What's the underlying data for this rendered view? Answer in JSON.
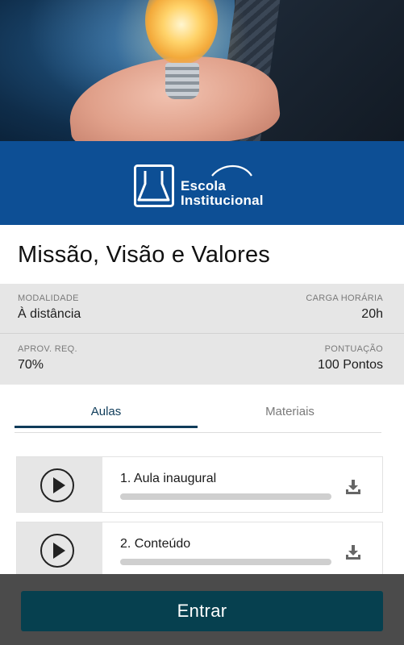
{
  "banner": {
    "logo_line1": "Escola",
    "logo_line2": "Institucional"
  },
  "course": {
    "title": "Missão, Visão e Valores"
  },
  "info": {
    "modalidade_label": "MODALIDADE",
    "modalidade_value": "À distância",
    "carga_label": "CARGA HORÁRIA",
    "carga_value": "20h",
    "aprov_label": "APROV. REQ.",
    "aprov_value": "70%",
    "pontuacao_label": "PONTUAÇÃO",
    "pontuacao_value": "100 Pontos"
  },
  "tabs": [
    {
      "label": "Aulas",
      "active": true
    },
    {
      "label": "Materiais",
      "active": false
    }
  ],
  "lessons": [
    {
      "title": "1. Aula inaugural",
      "progress": 0
    },
    {
      "title": "2. Conteúdo",
      "progress": 0
    }
  ],
  "footer": {
    "enter_label": "Entrar"
  },
  "colors": {
    "banner": "#0d4f95",
    "accent": "#0f3c5a",
    "button": "#06404f",
    "footer": "#4b4b4b"
  },
  "icons": {
    "play": "play-circle-icon",
    "download": "download-icon"
  }
}
